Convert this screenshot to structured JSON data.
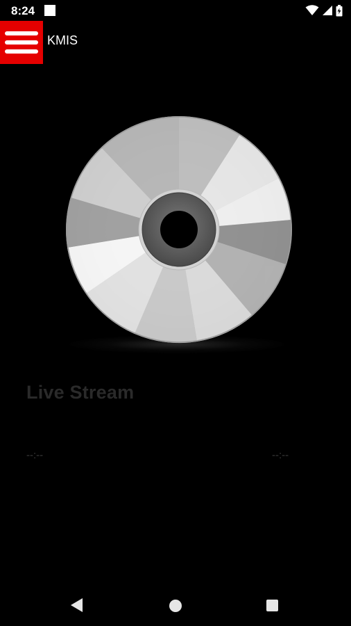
{
  "status_bar": {
    "time": "8:24",
    "icons": [
      "notification-square-icon",
      "wifi-icon",
      "cell-signal-icon",
      "battery-icon"
    ]
  },
  "app_bar": {
    "title": "KMIS",
    "menu_icon": "hamburger-menu-icon",
    "accent_color": "#e50000"
  },
  "player": {
    "artwork_icon": "compact-disc-icon",
    "stream_title": "Live Stream",
    "elapsed_time": "--:--",
    "total_time": "--:--"
  },
  "nav_bar": {
    "icons": [
      "back-icon",
      "home-icon",
      "recent-apps-icon"
    ]
  }
}
